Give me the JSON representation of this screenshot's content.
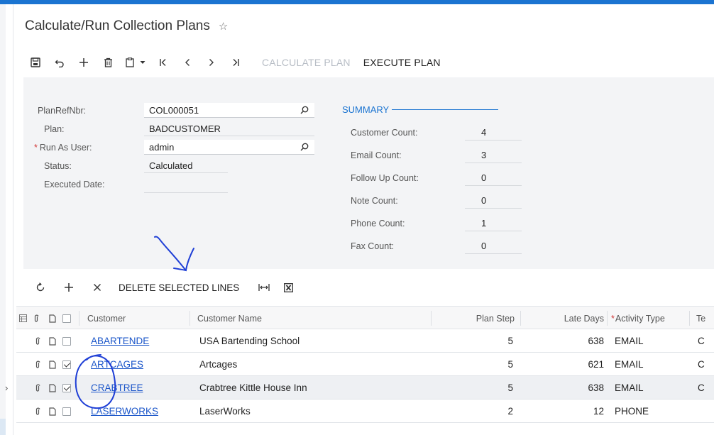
{
  "page": {
    "title": "Calculate/Run Collection Plans"
  },
  "toolbar": {
    "calculate_plan": "CALCULATE PLAN",
    "execute_plan": "EXECUTE PLAN"
  },
  "form": {
    "plan_ref_nbr": {
      "label": "PlanRefNbr:",
      "value": "COL000051"
    },
    "plan": {
      "label": "Plan:",
      "value": "BADCUSTOMER"
    },
    "run_as_user": {
      "label": "Run As User:",
      "required_mark": "*",
      "value": "admin"
    },
    "status": {
      "label": "Status:",
      "value": "Calculated"
    },
    "executed_date": {
      "label": "Executed Date:",
      "value": ""
    }
  },
  "summary": {
    "heading": "SUMMARY",
    "customer_count": {
      "label": "Customer Count:",
      "value": "4"
    },
    "email_count": {
      "label": "Email Count:",
      "value": "3"
    },
    "follow_up_count": {
      "label": "Follow Up Count:",
      "value": "0"
    },
    "note_count": {
      "label": "Note Count:",
      "value": "0"
    },
    "phone_count": {
      "label": "Phone Count:",
      "value": "1"
    },
    "fax_count": {
      "label": "Fax Count:",
      "value": "0"
    }
  },
  "grid_toolbar": {
    "delete_selected": "DELETE SELECTED LINES"
  },
  "grid": {
    "columns": {
      "customer": "Customer",
      "customer_name": "Customer Name",
      "plan_step": "Plan Step",
      "late_days": "Late Days",
      "activity_type": "Activity Type",
      "activity_type_required": "*",
      "te": "Te"
    },
    "rows": [
      {
        "customer": "ABARTENDE",
        "customer_name": "USA Bartending School",
        "plan_step": "5",
        "late_days": "638",
        "activity_type": "EMAIL",
        "te": "C",
        "checked": false,
        "current": false
      },
      {
        "customer": "ARTCAGES",
        "customer_name": "Artcages",
        "plan_step": "5",
        "late_days": "621",
        "activity_type": "EMAIL",
        "te": "C",
        "checked": true,
        "current": false
      },
      {
        "customer": "CRABTREE",
        "customer_name": "Crabtree Kittle House Inn",
        "plan_step": "5",
        "late_days": "638",
        "activity_type": "EMAIL",
        "te": "C",
        "checked": true,
        "current": true
      },
      {
        "customer": "LASERWORKS",
        "customer_name": "LaserWorks",
        "plan_step": "2",
        "late_days": "12",
        "activity_type": "PHONE",
        "te": "",
        "checked": false,
        "current": false
      }
    ]
  },
  "colors": {
    "accent": "#1b74d1",
    "link": "#1a55c9",
    "annotation": "#1f3fd6",
    "disabled_text": "#b8bec6"
  }
}
